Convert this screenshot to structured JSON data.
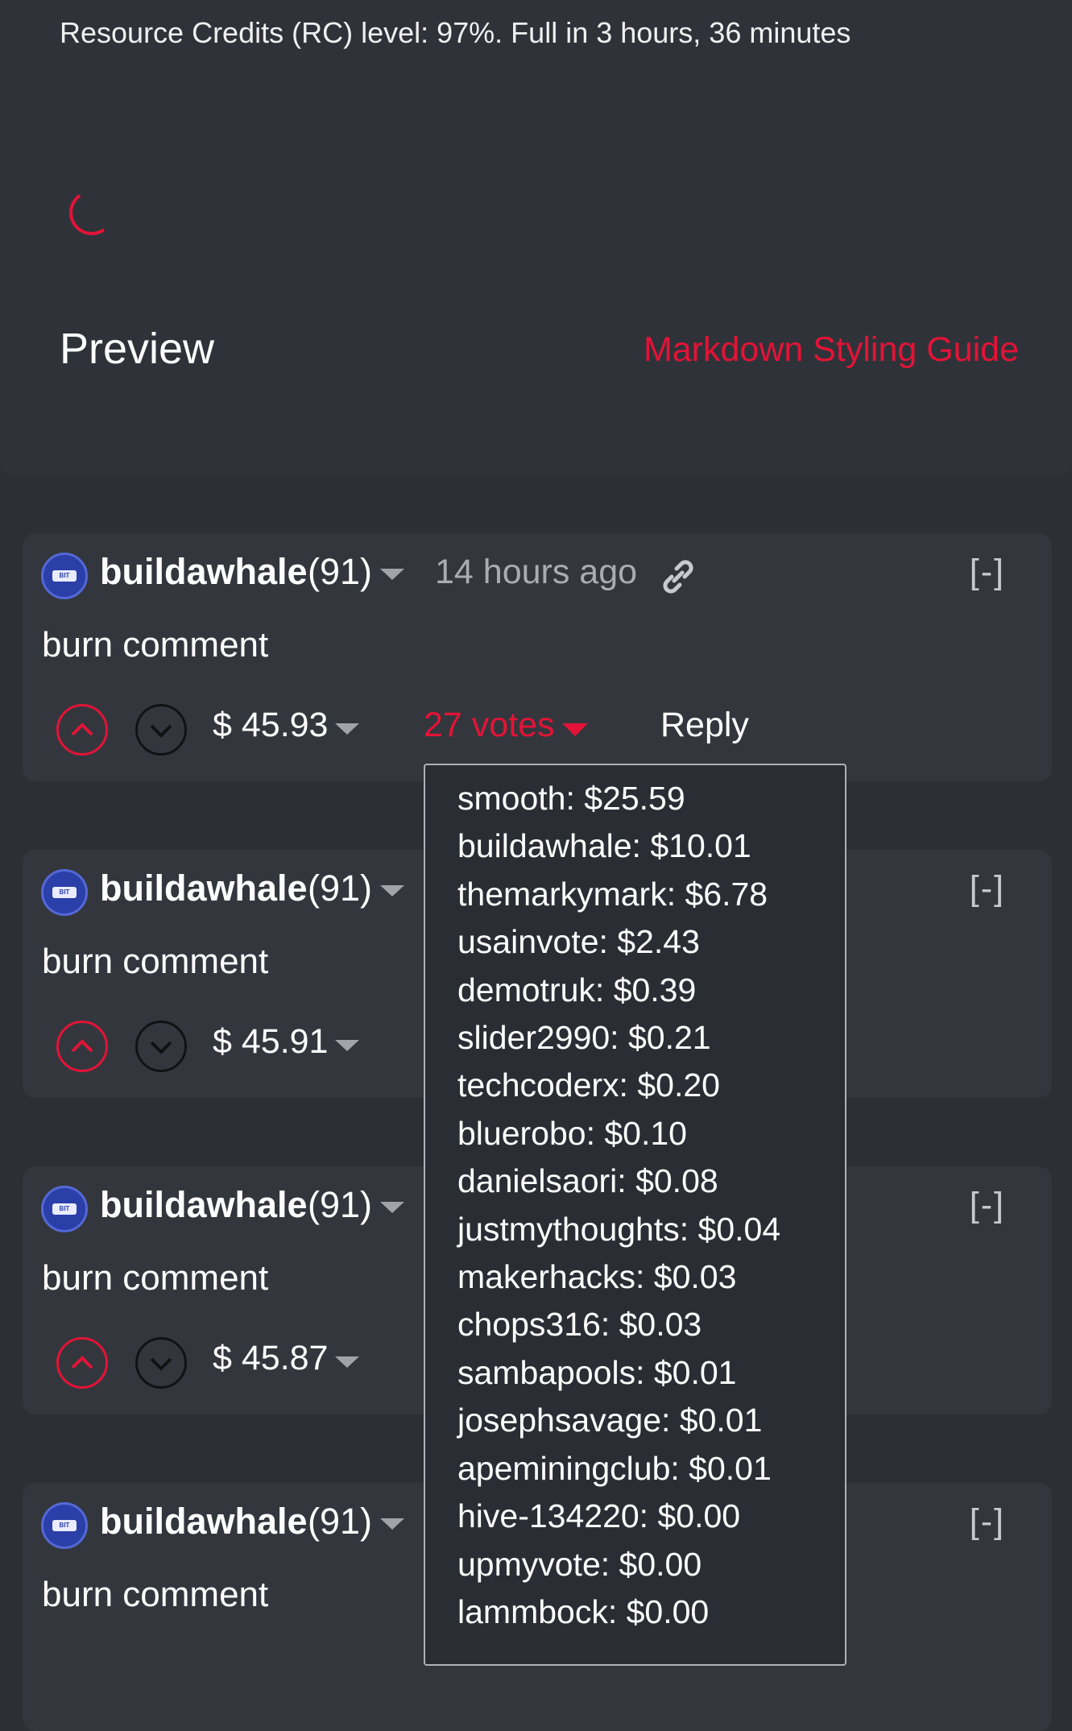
{
  "editor": {
    "rc_text": "Resource Credits (RC) level: 97%. Full in 3 hours, 36 minutes",
    "preview_title": "Preview",
    "markdown_guide": "Markdown Styling Guide"
  },
  "comments": [
    {
      "author": "buildawhale",
      "reputation": "(91)",
      "time": "14 hours ago",
      "body": "burn comment",
      "payout": "$ 45.93",
      "votes": "27 votes",
      "reply": "Reply",
      "collapse": "[-]"
    },
    {
      "author": "buildawhale",
      "reputation": "(91)",
      "body": "burn comment",
      "payout": "$ 45.91",
      "collapse": "[-]"
    },
    {
      "author": "buildawhale",
      "reputation": "(91)",
      "body": "burn comment",
      "payout": "$ 45.87",
      "collapse": "[-]"
    },
    {
      "author": "buildawhale",
      "reputation": "(91)",
      "body": "burn comment",
      "collapse": "[-]"
    }
  ],
  "voters": [
    "smooth: $25.59",
    "buildawhale: $10.01",
    "themarkymark: $6.78",
    "usainvote: $2.43",
    "demotruk: $0.39",
    "slider2990: $0.21",
    "techcoderx: $0.20",
    "bluerobo: $0.10",
    "danielsaori: $0.08",
    "justmythoughts: $0.04",
    "makerhacks: $0.03",
    "chops316: $0.03",
    "sambapools: $0.01",
    "josephsavage: $0.01",
    "apeminingclub: $0.01",
    "hive-134220: $0.00",
    "upmyvote: $0.00",
    "lammbock: $0.00"
  ],
  "colors": {
    "accent": "#e31337",
    "background": "#2c2f33",
    "card": "#33373d"
  }
}
